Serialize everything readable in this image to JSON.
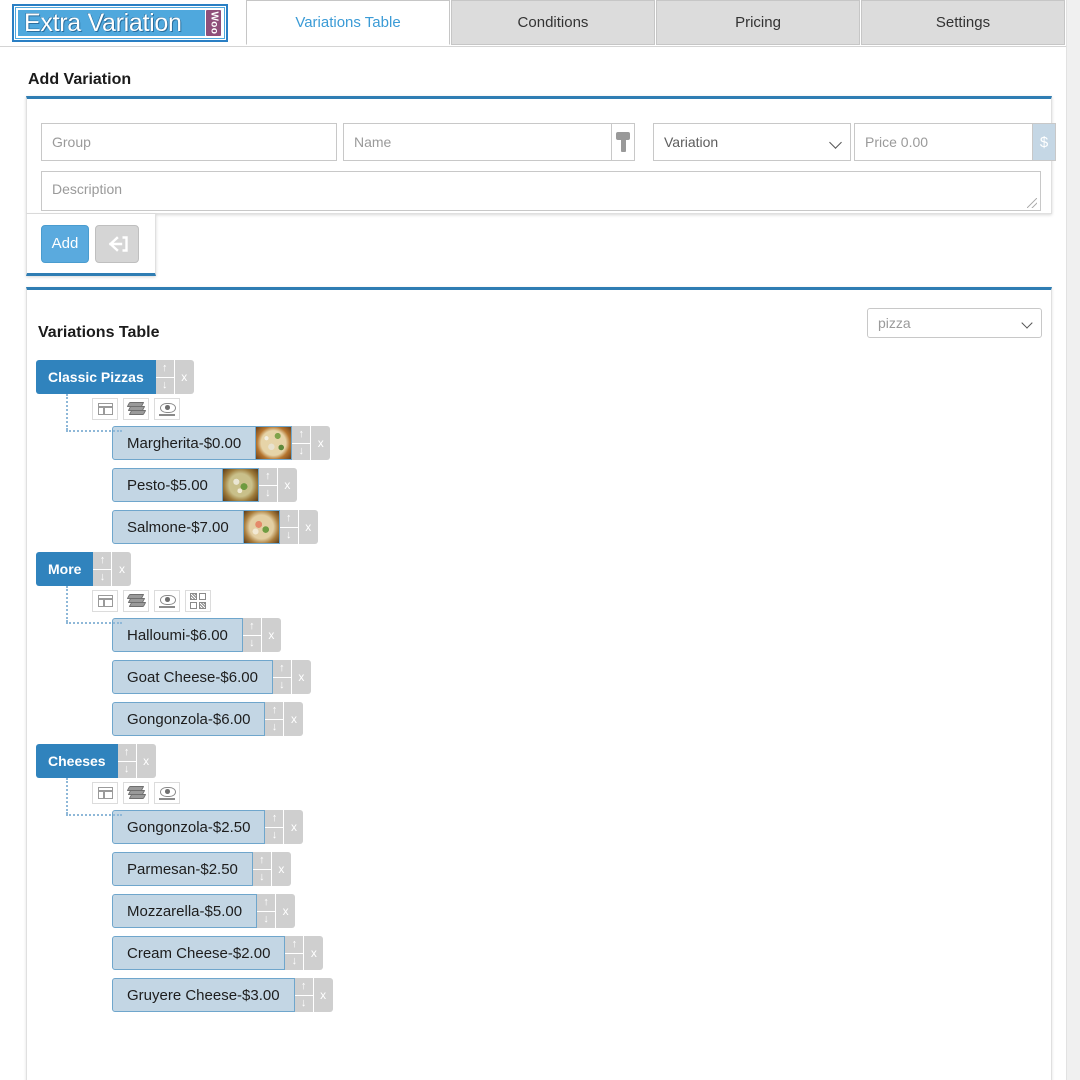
{
  "brand": {
    "logo_text": "Extra Variation",
    "badge_text": "Woo"
  },
  "tabs": [
    {
      "label": "Variations Table",
      "active": true
    },
    {
      "label": "Conditions",
      "active": false
    },
    {
      "label": "Pricing",
      "active": false
    },
    {
      "label": "Settings",
      "active": false
    }
  ],
  "add_variation": {
    "title": "Add Variation",
    "group_placeholder": "Group",
    "name_placeholder": "Name",
    "variation_selected": "Variation",
    "price_placeholder": "Price 0.00",
    "currency_symbol": "$",
    "description_placeholder": "Description",
    "add_label": "Add",
    "text_tool_icon": "text-format-icon",
    "import_icon": "import-arrow-icon"
  },
  "variations_table": {
    "title": "Variations Table",
    "product_selected": "pizza",
    "controls": {
      "up": "↑",
      "down": "↓",
      "remove": "x"
    },
    "groups": [
      {
        "name": "Classic Pizzas",
        "tools": [
          "table-icon",
          "layers-icon",
          "preview-eye-icon"
        ],
        "items": [
          {
            "label": "Margherita-$0.00",
            "thumb": "pizza-margherita"
          },
          {
            "label": "Pesto-$5.00",
            "thumb": "pizza-pesto"
          },
          {
            "label": "Salmone-$7.00",
            "thumb": "pizza-salmone"
          }
        ]
      },
      {
        "name": "More",
        "tools": [
          "table-icon",
          "layers-icon",
          "preview-eye-icon",
          "grid-swatch-icon"
        ],
        "items": [
          {
            "label": "Halloumi-$6.00",
            "thumb": null
          },
          {
            "label": "Goat Cheese-$6.00",
            "thumb": null
          },
          {
            "label": "Gongonzola-$6.00",
            "thumb": null
          }
        ]
      },
      {
        "name": "Cheeses",
        "tools": [
          "table-icon",
          "layers-icon",
          "preview-eye-icon"
        ],
        "items": [
          {
            "label": "Gongonzola-$2.50",
            "thumb": null
          },
          {
            "label": "Parmesan-$2.50",
            "thumb": null
          },
          {
            "label": "Mozzarella-$5.00",
            "thumb": null
          },
          {
            "label": "Cream Cheese-$2.00",
            "thumb": null
          },
          {
            "label": "Gruyere Cheese-$3.00",
            "thumb": null
          }
        ]
      }
    ]
  },
  "colors": {
    "accent_blue": "#3083bd",
    "panel_top_border": "#2f7db3",
    "tab_active_text": "#3b9bd6",
    "item_bg": "#c3d6e4",
    "item_border": "#6fa6cc",
    "button_add": "#5aaade",
    "badge_purple": "#8f4f7a"
  }
}
